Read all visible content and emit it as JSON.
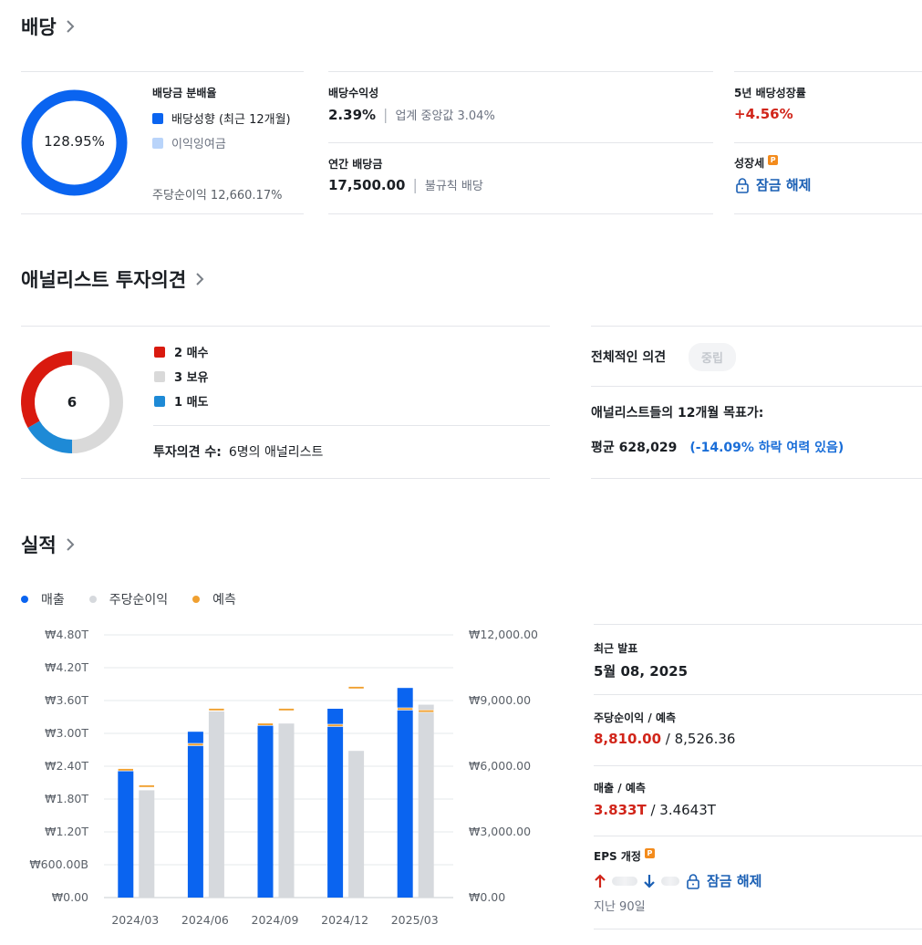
{
  "dividend": {
    "title": "배당",
    "payout_ratio_label": "배당금 분배율",
    "payout_ratio_value": "128.95%",
    "legend_trend": "배당성향 (최근 12개월)",
    "legend_retained": "이익잉여금",
    "eps_payout": "주당순이익 12,660.17%",
    "yield_label": "배당수익성",
    "yield_value": "2.39%",
    "industry_median": "업계 중앙값 3.04%",
    "annual_label": "연간 배당금",
    "annual_value": "17,500.00",
    "annual_note": "불규칙 배당",
    "growth5y_label": "5년 배당성장률",
    "growth5y_value": "+4.56%",
    "growth_label": "성장세",
    "unlock_label": "잠금 해제",
    "premium_badge": "P"
  },
  "analyst": {
    "title": "애널리스트 투자의견",
    "total": "6",
    "legend": [
      {
        "label": "2 매수",
        "color": "#d91a0f"
      },
      {
        "label": "3 보유",
        "color": "#d9d9d9"
      },
      {
        "label": "1 매도",
        "color": "#1e8ad6"
      }
    ],
    "count_label": "투자의견 수:",
    "count_value": "6명의 애널리스트",
    "overall_label": "전체적인 의견",
    "overall_value": "중립",
    "target_label": "애널리스트들의 12개월 목표가:",
    "target_avg": "평균 628,029",
    "target_change": "(-14.09% 하락 여력 있음)"
  },
  "earnings": {
    "title": "실적",
    "legend": [
      {
        "label": "매출",
        "color": "#0a64f0"
      },
      {
        "label": "주당순이익",
        "color": "#d6d9dd"
      },
      {
        "label": "예측",
        "color": "#f0a030"
      }
    ],
    "latest_label": "최근 발표",
    "latest_value": "5월 08, 2025",
    "eps_label": "주당순이익 / 예측",
    "eps_actual": "8,810.00",
    "eps_forecast": " / 8,526.36",
    "rev_label": "매출 / 예측",
    "rev_actual": "3.833T",
    "rev_forecast": " / 3.4643T",
    "eps_revision_label": "EPS 개정",
    "eps_revision_unlock": "잠금 해제",
    "eps_revision_note": "지난 90일"
  },
  "chart_data": {
    "type": "bar",
    "categories": [
      "2024/03",
      "2024/06",
      "2024/09",
      "2024/12",
      "2025/03"
    ],
    "series": [
      {
        "name": "매출",
        "axis": "left",
        "unit": "T",
        "values": [
          2.31,
          3.03,
          3.15,
          3.45,
          3.83
        ],
        "forecast": [
          2.34,
          2.8,
          3.17,
          3.15,
          3.45
        ]
      },
      {
        "name": "주당순이익",
        "axis": "right",
        "values": [
          4900,
          8500,
          7950,
          6700,
          8810
        ],
        "forecast": [
          5100,
          8600,
          8600,
          9600,
          8526
        ]
      }
    ],
    "left_axis": {
      "ylim": [
        0,
        4.8
      ],
      "ticks": [
        "₩0.00",
        "₩600.00B",
        "₩1.20T",
        "₩1.80T",
        "₩2.40T",
        "₩3.00T",
        "₩3.60T",
        "₩4.20T",
        "₩4.80T"
      ]
    },
    "right_axis": {
      "ylim": [
        0,
        12000
      ],
      "ticks": [
        "₩0.00",
        "₩3,000.00",
        "₩6,000.00",
        "₩9,000.00",
        "₩12,000.00"
      ]
    },
    "colors": {
      "revenue": "#0a64f0",
      "eps": "#d6d9dd",
      "forecast": "#f0a030"
    },
    "grid": true,
    "legend_position": "top-left"
  }
}
